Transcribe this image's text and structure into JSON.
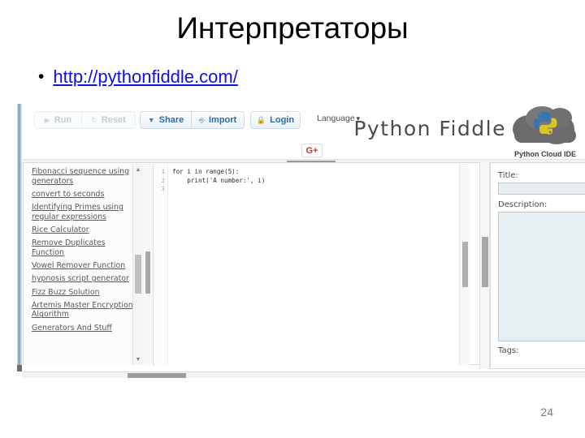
{
  "slide": {
    "title": "Интерпретаторы",
    "bullet_marker": "•",
    "link_text": "http://pythonfiddle.com/",
    "link_color": "#1111dd",
    "page_number": "24"
  },
  "screenshot": {
    "toolbar": {
      "run_label": "Run",
      "run_icon": "play-icon",
      "reset_label": "Reset",
      "reset_icon": "refresh-icon",
      "share_label": "Share",
      "share_icon": "caret-down-icon",
      "import_label": "Import",
      "import_icon": "import-arrow-icon",
      "login_label": "Login",
      "login_icon": "lock-icon",
      "language_label": "Language",
      "language_caret": "▼",
      "gplus_label": "G+"
    },
    "brand": {
      "name": "Python Fiddle",
      "caption": "Python Cloud IDE",
      "logo_icon": "python-cloud-logo"
    },
    "sidebar": {
      "items": [
        "Fibonacci sequence using generators",
        "convert to seconds",
        "Identifying Primes using regular expressions",
        "Rice Calculator",
        "Remove Duplicates Function",
        "Vowel Remover Function",
        "hypnosis script generator",
        "Fizz Buzz Solution",
        "Artemis Master Encryption Algorithm",
        "Generators And Stuff"
      ],
      "scroll_up_icon": "▲",
      "scroll_down_icon": "▼"
    },
    "editor": {
      "line_numbers": [
        "1",
        "2",
        "3"
      ],
      "code": "for i in range(5):\n    print('A number:', i)"
    },
    "properties": {
      "title_label": "Title:",
      "title_value": "",
      "title_placeholder": "",
      "description_label": "Description:",
      "description_value": "",
      "description_placeholder": "",
      "tags_label": "Tags:"
    }
  }
}
